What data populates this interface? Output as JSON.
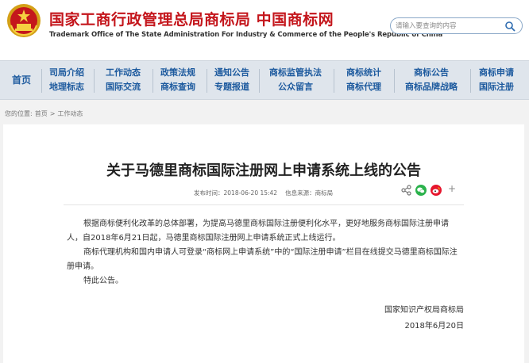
{
  "header": {
    "title_cn": "国家工商行政管理总局商标局  中国商标网",
    "title_en": "Trademark Office of The State Administration For Industry & Commerce of the People's Republic of China",
    "search_placeholder": "请输入要查询的内容"
  },
  "nav": {
    "home": "首页",
    "columns": [
      {
        "top": "司局介绍",
        "bottom": "地理标志"
      },
      {
        "top": "工作动态",
        "bottom": "国际交流"
      },
      {
        "top": "政策法规",
        "bottom": "商标查询"
      },
      {
        "top": "通知公告",
        "bottom": "专题报道"
      },
      {
        "top": "商标监管执法",
        "bottom": "公众留言"
      },
      {
        "top": "商标统计",
        "bottom": "商标代理"
      },
      {
        "top": "商标公告",
        "bottom": "商标品牌战略"
      },
      {
        "top": "商标申请",
        "bottom": "国际注册"
      }
    ]
  },
  "breadcrumb": {
    "label": "您的位置:",
    "home": "首页",
    "sep": ">",
    "current": "工作动态"
  },
  "article": {
    "title": "关于马德里商标国际注册网上申请系统上线的公告",
    "published": "发布时间：2018-06-20 15:42",
    "source": "信息来源：商标局",
    "paragraphs": [
      "根据商标便利化改革的总体部署，为提高马德里商标国际注册便利化水平，更好地服务商标国际注册申请人，自2018年6月21日起，马德里商标国际注册网上申请系统正式上线运行。",
      "商标代理机构和国内申请人可登录“商标网上申请系统”中的“国际注册申请”栏目在线提交马德里商标国际注册申请。",
      "特此公告。"
    ],
    "signature": "国家知识产权局商标局",
    "date": "2018年6月20日",
    "share_more": "+"
  },
  "colors": {
    "brand_red": "#c4161c",
    "nav_blue": "#1d5a9e",
    "wechat_green": "#2bb24c",
    "weibo_red": "#e6162d"
  },
  "icons": [
    "national-emblem-icon",
    "search-icon",
    "share-icon",
    "wechat-icon",
    "weibo-icon"
  ]
}
